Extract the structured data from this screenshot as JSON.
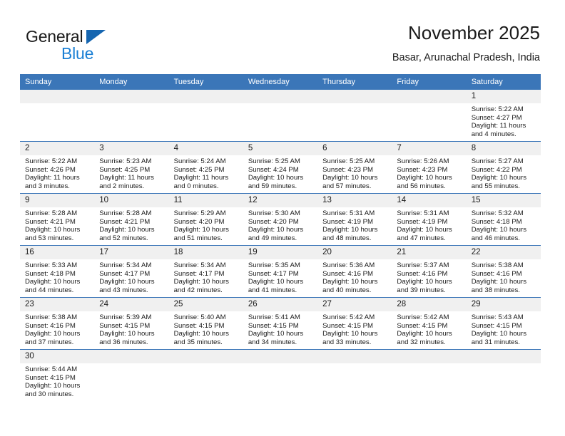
{
  "brand": {
    "line1": "General",
    "line2": "Blue",
    "triangle_color": "#1565b0",
    "blue_text_color": "#1a7fd4"
  },
  "header": {
    "month_title": "November 2025",
    "location": "Basar, Arunachal Pradesh, India"
  },
  "theme": {
    "header_blue": "#3b76b8",
    "daynum_band": "#f0f0f0",
    "text": "#1a1a1a"
  },
  "calendar": {
    "weekday_headers": [
      "Sunday",
      "Monday",
      "Tuesday",
      "Wednesday",
      "Thursday",
      "Friday",
      "Saturday"
    ],
    "labels": {
      "sunrise": "Sunrise:",
      "sunset": "Sunset:",
      "daylight": "Daylight:"
    },
    "weeks": [
      [
        {
          "day": "",
          "empty": true
        },
        {
          "day": "",
          "empty": true
        },
        {
          "day": "",
          "empty": true
        },
        {
          "day": "",
          "empty": true
        },
        {
          "day": "",
          "empty": true
        },
        {
          "day": "",
          "empty": true
        },
        {
          "day": "1",
          "sunrise": "Sunrise: 5:22 AM",
          "sunset": "Sunset: 4:27 PM",
          "daylight": "Daylight: 11 hours and 4 minutes."
        }
      ],
      [
        {
          "day": "2",
          "sunrise": "Sunrise: 5:22 AM",
          "sunset": "Sunset: 4:26 PM",
          "daylight": "Daylight: 11 hours and 3 minutes."
        },
        {
          "day": "3",
          "sunrise": "Sunrise: 5:23 AM",
          "sunset": "Sunset: 4:25 PM",
          "daylight": "Daylight: 11 hours and 2 minutes."
        },
        {
          "day": "4",
          "sunrise": "Sunrise: 5:24 AM",
          "sunset": "Sunset: 4:25 PM",
          "daylight": "Daylight: 11 hours and 0 minutes."
        },
        {
          "day": "5",
          "sunrise": "Sunrise: 5:25 AM",
          "sunset": "Sunset: 4:24 PM",
          "daylight": "Daylight: 10 hours and 59 minutes."
        },
        {
          "day": "6",
          "sunrise": "Sunrise: 5:25 AM",
          "sunset": "Sunset: 4:23 PM",
          "daylight": "Daylight: 10 hours and 57 minutes."
        },
        {
          "day": "7",
          "sunrise": "Sunrise: 5:26 AM",
          "sunset": "Sunset: 4:23 PM",
          "daylight": "Daylight: 10 hours and 56 minutes."
        },
        {
          "day": "8",
          "sunrise": "Sunrise: 5:27 AM",
          "sunset": "Sunset: 4:22 PM",
          "daylight": "Daylight: 10 hours and 55 minutes."
        }
      ],
      [
        {
          "day": "9",
          "sunrise": "Sunrise: 5:28 AM",
          "sunset": "Sunset: 4:21 PM",
          "daylight": "Daylight: 10 hours and 53 minutes."
        },
        {
          "day": "10",
          "sunrise": "Sunrise: 5:28 AM",
          "sunset": "Sunset: 4:21 PM",
          "daylight": "Daylight: 10 hours and 52 minutes."
        },
        {
          "day": "11",
          "sunrise": "Sunrise: 5:29 AM",
          "sunset": "Sunset: 4:20 PM",
          "daylight": "Daylight: 10 hours and 51 minutes."
        },
        {
          "day": "12",
          "sunrise": "Sunrise: 5:30 AM",
          "sunset": "Sunset: 4:20 PM",
          "daylight": "Daylight: 10 hours and 49 minutes."
        },
        {
          "day": "13",
          "sunrise": "Sunrise: 5:31 AM",
          "sunset": "Sunset: 4:19 PM",
          "daylight": "Daylight: 10 hours and 48 minutes."
        },
        {
          "day": "14",
          "sunrise": "Sunrise: 5:31 AM",
          "sunset": "Sunset: 4:19 PM",
          "daylight": "Daylight: 10 hours and 47 minutes."
        },
        {
          "day": "15",
          "sunrise": "Sunrise: 5:32 AM",
          "sunset": "Sunset: 4:18 PM",
          "daylight": "Daylight: 10 hours and 46 minutes."
        }
      ],
      [
        {
          "day": "16",
          "sunrise": "Sunrise: 5:33 AM",
          "sunset": "Sunset: 4:18 PM",
          "daylight": "Daylight: 10 hours and 44 minutes."
        },
        {
          "day": "17",
          "sunrise": "Sunrise: 5:34 AM",
          "sunset": "Sunset: 4:17 PM",
          "daylight": "Daylight: 10 hours and 43 minutes."
        },
        {
          "day": "18",
          "sunrise": "Sunrise: 5:34 AM",
          "sunset": "Sunset: 4:17 PM",
          "daylight": "Daylight: 10 hours and 42 minutes."
        },
        {
          "day": "19",
          "sunrise": "Sunrise: 5:35 AM",
          "sunset": "Sunset: 4:17 PM",
          "daylight": "Daylight: 10 hours and 41 minutes."
        },
        {
          "day": "20",
          "sunrise": "Sunrise: 5:36 AM",
          "sunset": "Sunset: 4:16 PM",
          "daylight": "Daylight: 10 hours and 40 minutes."
        },
        {
          "day": "21",
          "sunrise": "Sunrise: 5:37 AM",
          "sunset": "Sunset: 4:16 PM",
          "daylight": "Daylight: 10 hours and 39 minutes."
        },
        {
          "day": "22",
          "sunrise": "Sunrise: 5:38 AM",
          "sunset": "Sunset: 4:16 PM",
          "daylight": "Daylight: 10 hours and 38 minutes."
        }
      ],
      [
        {
          "day": "23",
          "sunrise": "Sunrise: 5:38 AM",
          "sunset": "Sunset: 4:16 PM",
          "daylight": "Daylight: 10 hours and 37 minutes."
        },
        {
          "day": "24",
          "sunrise": "Sunrise: 5:39 AM",
          "sunset": "Sunset: 4:15 PM",
          "daylight": "Daylight: 10 hours and 36 minutes."
        },
        {
          "day": "25",
          "sunrise": "Sunrise: 5:40 AM",
          "sunset": "Sunset: 4:15 PM",
          "daylight": "Daylight: 10 hours and 35 minutes."
        },
        {
          "day": "26",
          "sunrise": "Sunrise: 5:41 AM",
          "sunset": "Sunset: 4:15 PM",
          "daylight": "Daylight: 10 hours and 34 minutes."
        },
        {
          "day": "27",
          "sunrise": "Sunrise: 5:42 AM",
          "sunset": "Sunset: 4:15 PM",
          "daylight": "Daylight: 10 hours and 33 minutes."
        },
        {
          "day": "28",
          "sunrise": "Sunrise: 5:42 AM",
          "sunset": "Sunset: 4:15 PM",
          "daylight": "Daylight: 10 hours and 32 minutes."
        },
        {
          "day": "29",
          "sunrise": "Sunrise: 5:43 AM",
          "sunset": "Sunset: 4:15 PM",
          "daylight": "Daylight: 10 hours and 31 minutes."
        }
      ],
      [
        {
          "day": "30",
          "sunrise": "Sunrise: 5:44 AM",
          "sunset": "Sunset: 4:15 PM",
          "daylight": "Daylight: 10 hours and 30 minutes."
        },
        {
          "day": "",
          "empty": true
        },
        {
          "day": "",
          "empty": true
        },
        {
          "day": "",
          "empty": true
        },
        {
          "day": "",
          "empty": true
        },
        {
          "day": "",
          "empty": true
        },
        {
          "day": "",
          "empty": true
        }
      ]
    ]
  }
}
